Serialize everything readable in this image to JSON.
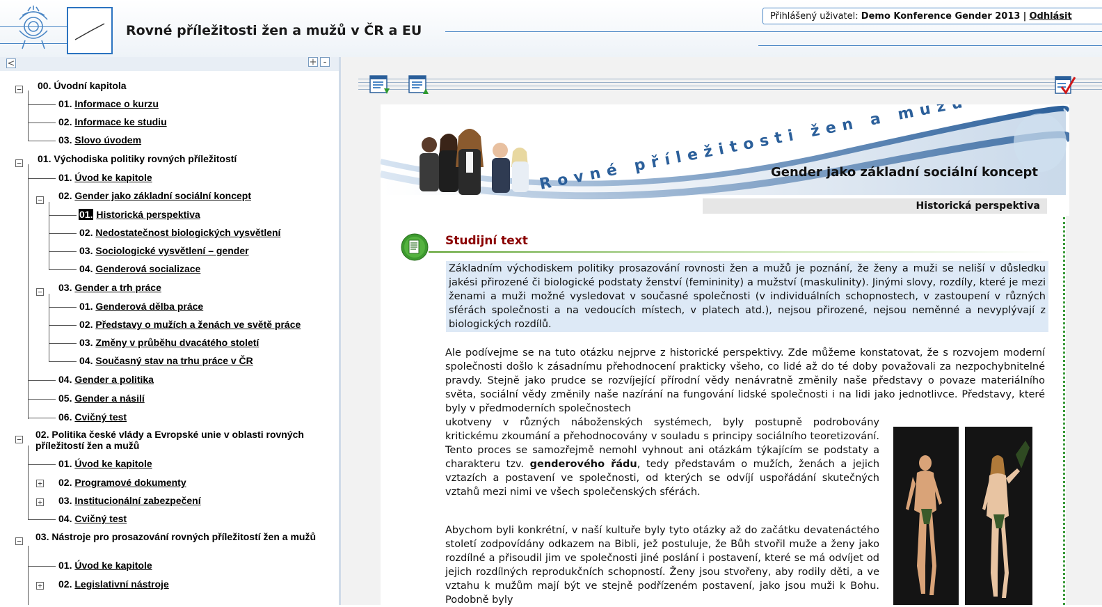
{
  "header": {
    "app_title": "Rovné příležitosti žen a mužů v ČR a EU",
    "user_label": "Přihlášený uživatel:",
    "user_name": "Demo Konference Gender 2013",
    "separator": "|",
    "logout_label": "Odhlásit"
  },
  "left_toolbar": {
    "collapse_label": "<",
    "expand_all_label": "+",
    "collapse_all_label": "-"
  },
  "tree": [
    {
      "number": "00.",
      "label": "Úvodní kapitola",
      "link": false
    },
    {
      "number": "01.",
      "label": "Informace o kurzu",
      "link": true
    },
    {
      "number": "02.",
      "label": "Informace ke studiu",
      "link": true
    },
    {
      "number": "03.",
      "label": "Slovo úvodem",
      "link": true
    },
    {
      "number": "01.",
      "label": "Východiska politiky rovných příležitostí",
      "link": false
    },
    {
      "number": "01.",
      "label": "Úvod ke kapitole",
      "link": true
    },
    {
      "number": "02.",
      "label": "Gender jako základní sociální koncept",
      "link": true
    },
    {
      "number": "01.",
      "label": "Historická perspektiva",
      "link": true,
      "current": true
    },
    {
      "number": "02.",
      "label": "Nedostatečnost biologických vysvětlení",
      "link": true
    },
    {
      "number": "03.",
      "label": "Sociologické vysvětlení – gender",
      "link": true
    },
    {
      "number": "04.",
      "label": "Genderová socializace",
      "link": true
    },
    {
      "number": "03.",
      "label": "Gender a trh práce",
      "link": true
    },
    {
      "number": "01.",
      "label": "Genderová dělba práce",
      "link": true
    },
    {
      "number": "02.",
      "label": "Představy o mužích a ženách ve světě práce",
      "link": true
    },
    {
      "number": "03.",
      "label": "Změny v průběhu dvacátého století",
      "link": true
    },
    {
      "number": "04.",
      "label": "Současný stav na trhu práce v ČR",
      "link": true
    },
    {
      "number": "04.",
      "label": "Gender a politika",
      "link": true
    },
    {
      "number": "05.",
      "label": "Gender a násilí",
      "link": true
    },
    {
      "number": "06.",
      "label": "Cvičný test",
      "link": true
    },
    {
      "number": "02.",
      "label": "Politika české vlády a Evropské unie v oblasti rovných příležitostí žen a mužů",
      "link": false
    },
    {
      "number": "01.",
      "label": "Úvod ke kapitole",
      "link": true
    },
    {
      "number": "02.",
      "label": "Programové dokumenty",
      "link": true
    },
    {
      "number": "03.",
      "label": "Institucionální zabezpečení",
      "link": true
    },
    {
      "number": "04.",
      "label": "Cvičný test",
      "link": true
    },
    {
      "number": "03.",
      "label": "Nástroje pro prosazování rovných příležitostí žen a mužů",
      "link": false
    },
    {
      "number": "01.",
      "label": "Úvod ke kapitole",
      "link": true
    },
    {
      "number": "02.",
      "label": "Legislativní nástroje",
      "link": true
    }
  ],
  "banner": {
    "slogan": "Rovné příležitosti žen a mužů",
    "title": "Gender jako základní sociální koncept",
    "subtitle": "Historická perspektiva"
  },
  "study": {
    "heading": "Studijní text",
    "intro": "Základním východiskem politiky prosazování rovnosti žen a mužů je poznání, že ženy a muži se neliší v důsledku jakési přirozené či biologické podstaty ženství (femininity) a mužství (maskulinity). Jinými slovy, rozdíly, které je mezi ženami a muži možné vysledovat v současné společnosti (v individuálních schopnostech, v zastoupení v různých sférách společnosti a na vedoucích místech, v platech atd.), nejsou přirozené, nejsou neměnné a nevyplývají z biologických rozdílů.",
    "para1": "Ale podívejme se na tuto otázku nejprve z historické perspektivy. Zde můžeme konstatovat, že s rozvojem moderní společnosti došlo k zásadnímu přehodnocení prakticky všeho, co lidé až do té doby považovali za nezpochybnitelné pravdy. Stejně jako prudce se rozvíjející přírodní vědy nenávratně změnily naše představy o povaze materiálního světa, sociální vědy změnily naše nazírání na fungování lidské společnosti i na lidi jako jednotlivce. Představy, které byly v předmoderních společnostech",
    "para2_start": "ukotveny v různých náboženských systémech, byly postupně podrobovány kritickému zkoumání a přehodnocovány v souladu s principy sociálního teoretizování. Tento proces se samozřejmě nemohl vyhnout ani otázkám týkajícím se podstaty a charakteru tzv.",
    "para2_bold": "genderového řádu",
    "para2_end": ", tedy představám o mužích, ženách a jejich vztazích a postavení ve společnosti, od kterých se odvíjí uspořádání skutečných vztahů mezi nimi ve všech společenských sférách.",
    "para3": "Abychom byli konkrétní, v naší kultuře byly tyto otázky až do začátku devatenáctého století zodpovídány odkazem na Bibli, jež postuluje, že Bůh stvořil muže a ženy jako rozdílné a přisoudil jim ve společnosti jiné poslání i postavení, které se má odvíjet od jejich rozdílných reprodukčních schopností. Ženy jsou stvořeny, aby rodily děti, a ve vztahu k mužům mají být ve stejně podřízeném postavení, jako jsou muži k Bohu. Podobně byly"
  },
  "colors": {
    "accent_blue": "#2b73c0",
    "heading_red": "#8b0000",
    "intro_bg": "#dde9f6",
    "dotted_green": "#3a9a3a"
  }
}
